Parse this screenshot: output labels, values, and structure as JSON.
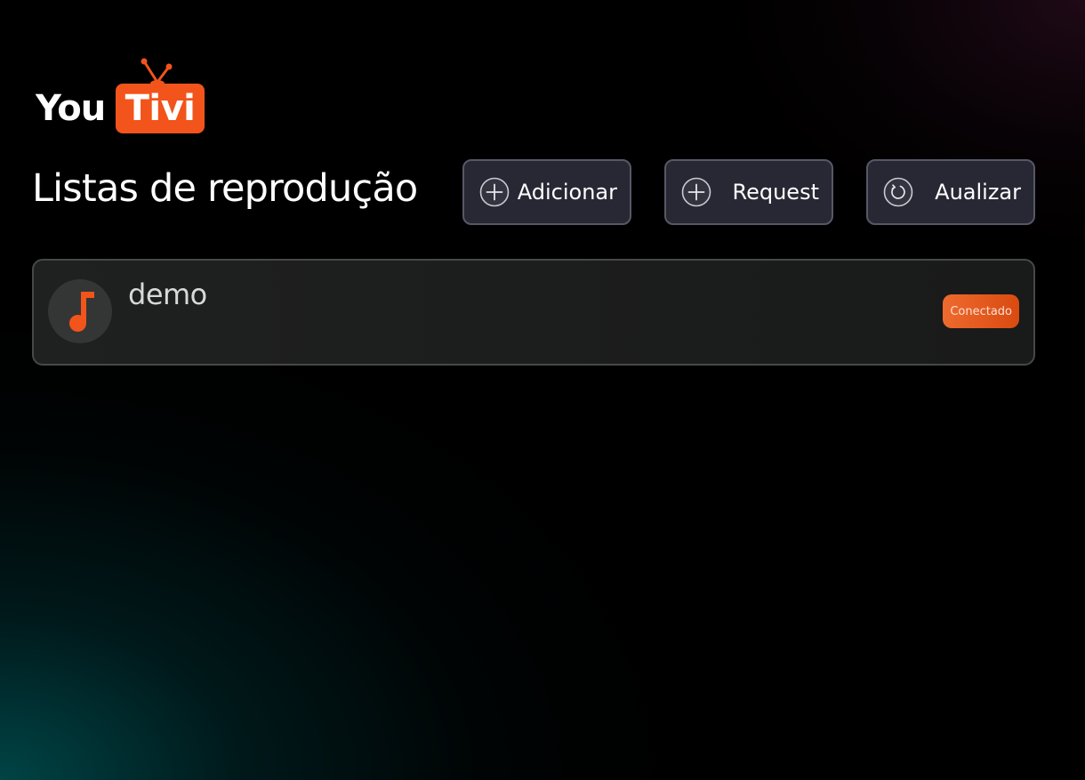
{
  "logo": {
    "part1": "You",
    "part2": "Tivi"
  },
  "header": {
    "title": "Listas de reprodução",
    "buttons": [
      {
        "label": "Adicionar",
        "icon": "plus-circle-icon"
      },
      {
        "label": "Request",
        "icon": "plus-circle-icon"
      },
      {
        "label": "Aualizar",
        "icon": "refresh-icon"
      }
    ]
  },
  "playlists": [
    {
      "name": "demo",
      "icon": "music-note-icon",
      "status": "Conectado"
    }
  ],
  "colors": {
    "accent": "#f2541b",
    "button_bg": "#272834",
    "button_border": "#575866",
    "card_bg": "#1c1d1d",
    "card_border": "#464849"
  }
}
